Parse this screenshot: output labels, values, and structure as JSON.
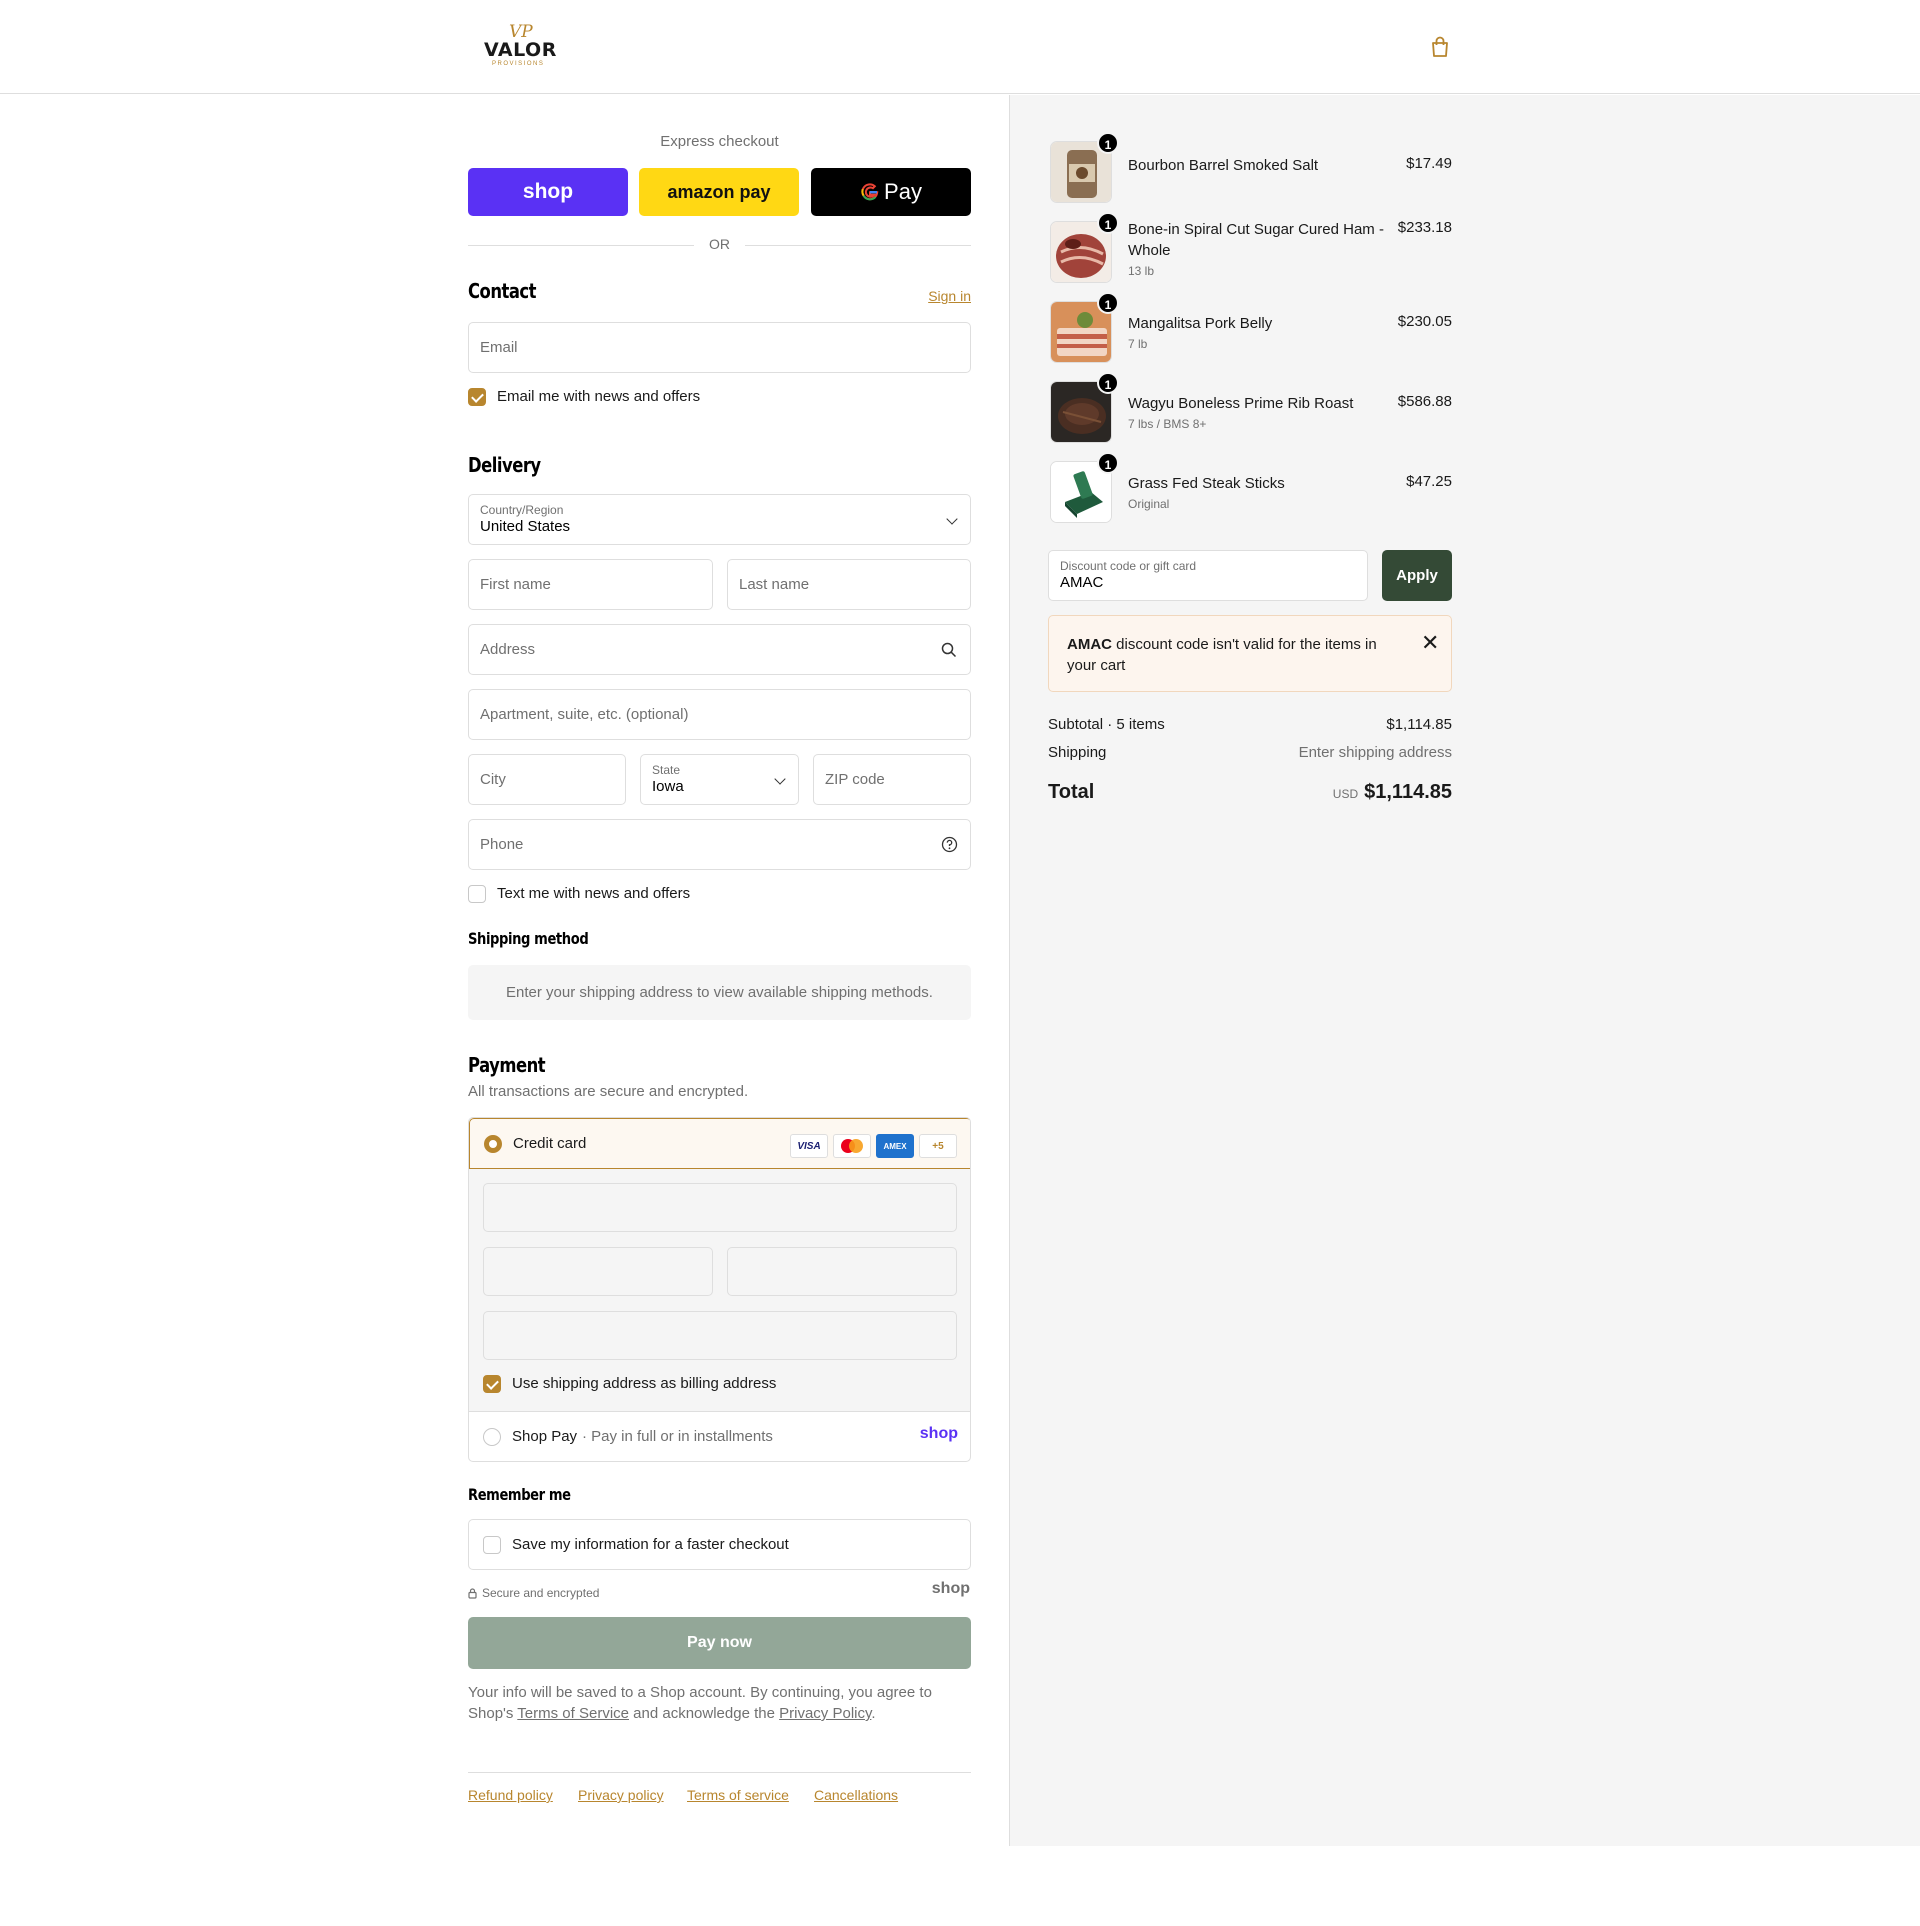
{
  "brand": {
    "logo_mark": "VP",
    "logo_word": "VALOR",
    "logo_sub": "PROVISIONS"
  },
  "express": {
    "title": "Express checkout",
    "shop": "shop",
    "amazon": "amazon pay",
    "gpay": "Pay",
    "or": "OR"
  },
  "contact": {
    "title": "Contact",
    "sign_in": "Sign in",
    "email_placeholder": "Email",
    "news_label": "Email me with news and offers",
    "news_checked": true
  },
  "delivery": {
    "title": "Delivery",
    "country_label": "Country/Region",
    "country_value": "United States",
    "first_name": "First name",
    "last_name": "Last name",
    "address": "Address",
    "apartment": "Apartment, suite, etc. (optional)",
    "city": "City",
    "state_label": "State",
    "state_value": "Iowa",
    "zip": "ZIP code",
    "phone": "Phone",
    "text_label": "Text me with news and offers",
    "text_checked": false
  },
  "shipping_method": {
    "title": "Shipping method",
    "note": "Enter your shipping address to view available shipping methods."
  },
  "payment": {
    "title": "Payment",
    "subtitle": "All transactions are secure and encrypted.",
    "credit_card": "Credit card",
    "card_icons": [
      "VISA",
      "Mastercard",
      "AMEX",
      "+5"
    ],
    "billing_label": "Use shipping address as billing address",
    "billing_checked": true,
    "shop_pay": "Shop Pay",
    "shop_pay_sub": "· Pay in full or in installments",
    "shop_pay_logo": "shop"
  },
  "remember": {
    "title": "Remember me",
    "save_label": "Save my information for a faster checkout",
    "secure": "Secure and encrypted",
    "shop_logo": "shop"
  },
  "pay_now": "Pay now",
  "fine_print": {
    "pre": "Your info will be saved to a Shop account. By continuing, you agree to Shop's ",
    "terms": "Terms of Service",
    "mid": " and acknowledge the ",
    "privacy": "Privacy Policy",
    "post": "."
  },
  "footer_links": [
    "Refund policy",
    "Privacy policy",
    "Terms of service",
    "Cancellations"
  ],
  "cart": {
    "items": [
      {
        "name": "Bourbon Barrel Smoked Salt",
        "variant": "",
        "price": "$17.49",
        "qty": "1"
      },
      {
        "name": "Bone-in Spiral Cut Sugar Cured Ham - Whole",
        "variant": "13 lb",
        "price": "$233.18",
        "qty": "1"
      },
      {
        "name": "Mangalitsa Pork Belly",
        "variant": "7 lb",
        "price": "$230.05",
        "qty": "1"
      },
      {
        "name": "Wagyu Boneless Prime Rib Roast",
        "variant": "7 lbs / BMS 8+",
        "price": "$586.88",
        "qty": "1"
      },
      {
        "name": "Grass Fed Steak Sticks",
        "variant": "Original",
        "price": "$47.25",
        "qty": "1"
      }
    ],
    "discount_label": "Discount code or gift card",
    "discount_value": "AMAC",
    "apply": "Apply",
    "error_code": "AMAC",
    "error_text": " discount code isn't valid for the items in your cart",
    "subtotal_label": "Subtotal · 5 items",
    "subtotal_value": "$1,114.85",
    "shipping_label": "Shipping",
    "shipping_value": "Enter shipping address",
    "total_label": "Total",
    "currency": "USD",
    "total_value": "$1,114.85"
  },
  "colors": {
    "accent": "#b8862e",
    "shop_purple": "#5a31f4",
    "amazon_yellow": "#ffd814",
    "apply_green": "#344a36",
    "paynow_disabled": "#93a798"
  },
  "icons": [
    "bag-icon",
    "chevron-down-icon",
    "search-icon",
    "help-icon",
    "lock-icon",
    "close-icon"
  ]
}
